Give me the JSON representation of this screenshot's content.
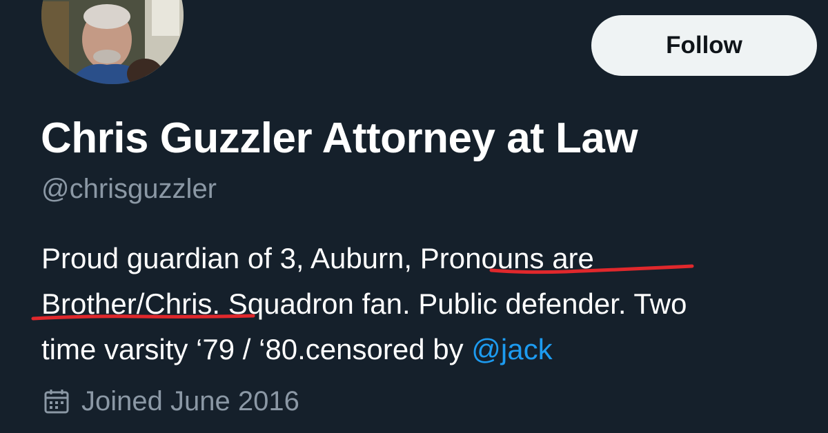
{
  "profile": {
    "display_name": "Chris Guzzler Attorney at Law",
    "handle": "@chrisguzzler",
    "follow_label": "Follow",
    "bio": {
      "line1_a": "Proud guardian of 3, Auburn, ",
      "line1_b": "Pronouns are",
      "line2_a": "Brother/Chris.",
      "line2_b": " Squadron fan. Public defender. Two",
      "line3_a": "time varsity ‘79 / ‘80.censored by ",
      "mention": "@jack"
    },
    "joined": "Joined June 2016"
  },
  "icons": {
    "avatar": "profile-photo",
    "calendar": "calendar-icon"
  },
  "colors": {
    "background": "#15202b",
    "text": "#ffffff",
    "muted": "#8b98a5",
    "link": "#1d9bf0",
    "follow_bg": "#eff3f4",
    "annotation": "#e0282c"
  }
}
